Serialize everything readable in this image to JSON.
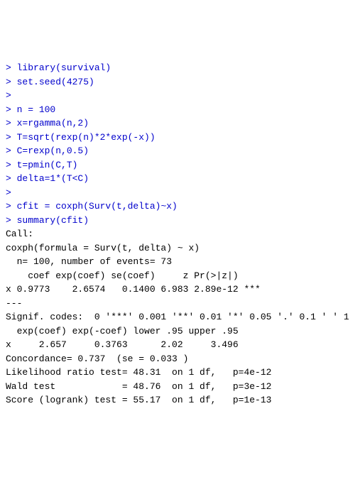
{
  "lines": [
    {
      "prompt": "> ",
      "text": "library(survival)",
      "type": "input"
    },
    {
      "prompt": "> ",
      "text": "set.seed(4275)",
      "type": "input"
    },
    {
      "prompt": "> ",
      "text": "",
      "type": "input"
    },
    {
      "prompt": "> ",
      "text": "n = 100",
      "type": "input"
    },
    {
      "prompt": "> ",
      "text": "x=rgamma(n,2)",
      "type": "input"
    },
    {
      "prompt": "> ",
      "text": "T=sqrt(rexp(n)*2*exp(-x))",
      "type": "input"
    },
    {
      "prompt": "> ",
      "text": "C=rexp(n,0.5)",
      "type": "input"
    },
    {
      "prompt": "> ",
      "text": "t=pmin(C,T)",
      "type": "input"
    },
    {
      "prompt": "> ",
      "text": "delta=1*(T<C)",
      "type": "input"
    },
    {
      "prompt": "> ",
      "text": "",
      "type": "input"
    },
    {
      "prompt": "> ",
      "text": "cfit = coxph(Surv(t,delta)~x)",
      "type": "input"
    },
    {
      "prompt": "> ",
      "text": "summary(cfit)",
      "type": "input"
    },
    {
      "prompt": "",
      "text": "Call:",
      "type": "output"
    },
    {
      "prompt": "",
      "text": "coxph(formula = Surv(t, delta) ~ x)",
      "type": "output"
    },
    {
      "prompt": "",
      "text": "",
      "type": "output"
    },
    {
      "prompt": "",
      "text": "  n= 100, number of events= 73",
      "type": "output"
    },
    {
      "prompt": "",
      "text": "",
      "type": "output"
    },
    {
      "prompt": "",
      "text": "    coef exp(coef) se(coef)     z Pr(>|z|)",
      "type": "output"
    },
    {
      "prompt": "",
      "text": "x 0.9773    2.6574   0.1400 6.983 2.89e-12 ***",
      "type": "output"
    },
    {
      "prompt": "",
      "text": "---",
      "type": "output"
    },
    {
      "prompt": "",
      "text": "Signif. codes:  0 '***' 0.001 '**' 0.01 '*' 0.05 '.' 0.1 ' ' 1",
      "type": "output"
    },
    {
      "prompt": "",
      "text": "",
      "type": "output"
    },
    {
      "prompt": "",
      "text": "  exp(coef) exp(-coef) lower .95 upper .95",
      "type": "output"
    },
    {
      "prompt": "",
      "text": "x     2.657     0.3763      2.02     3.496",
      "type": "output"
    },
    {
      "prompt": "",
      "text": "",
      "type": "output"
    },
    {
      "prompt": "",
      "text": "Concordance= 0.737  (se = 0.033 )",
      "type": "output"
    },
    {
      "prompt": "",
      "text": "Likelihood ratio test= 48.31  on 1 df,   p=4e-12",
      "type": "output"
    },
    {
      "prompt": "",
      "text": "Wald test            = 48.76  on 1 df,   p=3e-12",
      "type": "output"
    },
    {
      "prompt": "",
      "text": "Score (logrank) test = 55.17  on 1 df,   p=1e-13",
      "type": "output"
    },
    {
      "prompt": "",
      "text": "",
      "type": "output"
    }
  ]
}
